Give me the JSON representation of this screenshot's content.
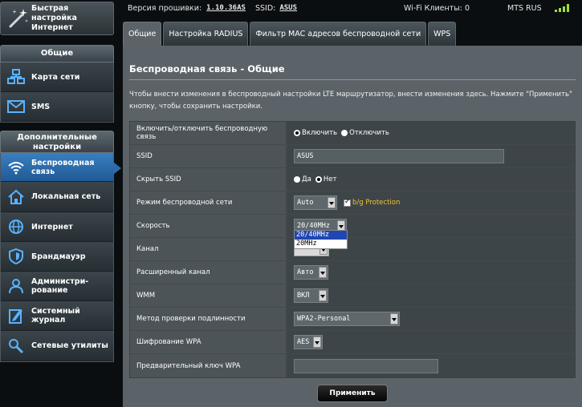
{
  "sidebar": {
    "quick_setup_label": "Быстрая настройка Интернет",
    "general_header": "Общие",
    "general_items": [
      {
        "label": "Карта сети",
        "icon": "network-map-icon"
      },
      {
        "label": "SMS",
        "icon": "sms-icon"
      }
    ],
    "advanced_header": "Дополнительные настройки",
    "advanced_items": [
      {
        "label": "Беспроводная связь",
        "icon": "wireless-icon",
        "active": true
      },
      {
        "label": "Локальная сеть",
        "icon": "lan-icon"
      },
      {
        "label": "Интернет",
        "icon": "globe-icon"
      },
      {
        "label": "Брандмауэр",
        "icon": "firewall-icon"
      },
      {
        "label": "Администри-рование",
        "icon": "admin-icon"
      },
      {
        "label": "Системный журнал",
        "icon": "log-icon"
      },
      {
        "label": "Сетевые утилиты",
        "icon": "tools-icon"
      }
    ]
  },
  "topbar": {
    "firmware_label": "Версия прошивки:",
    "firmware_value": "1.10.36AS",
    "ssid_label": "SSID:",
    "ssid_value": "ASUS",
    "clients_label": "Wi-Fi Клиенты: 0",
    "operator": "MTS RUS"
  },
  "tabs": [
    {
      "label": "Общие",
      "active": true
    },
    {
      "label": "Настройка RADIUS"
    },
    {
      "label": "Фильтр MAC адресов беспроводной сети"
    },
    {
      "label": "WPS"
    }
  ],
  "panel": {
    "title": "Беспроводная связь - Общие",
    "description": "Чтобы внести изменения в беспроводный настройки LTE маршрутизатор, внести изменения здесь. Нажмите \"Применить\" кнопку, чтобы сохранить настройки."
  },
  "form": {
    "wireless_toggle": {
      "label": "Включить/отключить беспроводную связь",
      "on_label": "Включить",
      "off_label": "Отключить",
      "selected": "on"
    },
    "ssid": {
      "label": "SSID",
      "value": "ASUS"
    },
    "hide_ssid": {
      "label": "Скрыть SSID",
      "yes_label": "Да",
      "no_label": "Нет",
      "selected": "no"
    },
    "mode": {
      "label": "Режим беспроводной сети",
      "value": "Auto",
      "bg_protection_label": "b/g Protection",
      "bg_protection_checked": true
    },
    "speed": {
      "label": "Скорость",
      "value": "20/40MHz",
      "options": [
        "20/40MHz",
        "20MHz"
      ]
    },
    "channel": {
      "label": "Канал"
    },
    "ext_channel": {
      "label": "Расширенный канал",
      "value": "Авто"
    },
    "wmm": {
      "label": "WMM",
      "value": "ВКЛ"
    },
    "auth_method": {
      "label": "Метод проверки подлинности",
      "value": "WPA2-Personal"
    },
    "wpa_encryption": {
      "label": "Шифрование WPA",
      "value": "AES"
    },
    "wpa_key": {
      "label": "Предварительный ключ WPA",
      "value": ""
    }
  },
  "apply_label": "Применить",
  "colors": {
    "accent": "#2d6aa8",
    "signal": "#9be03a",
    "bg_protection": "#f2c230"
  }
}
